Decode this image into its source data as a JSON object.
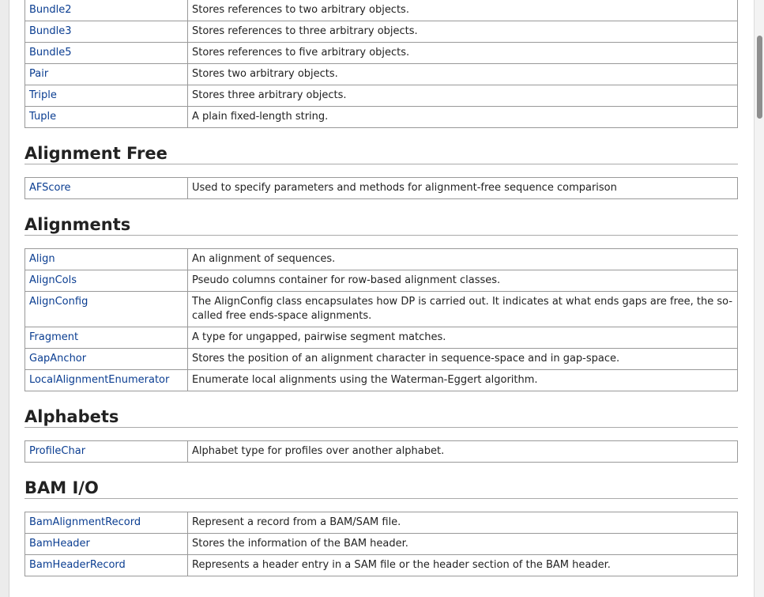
{
  "sections": [
    {
      "heading": "",
      "rows": [
        {
          "name": "Bundle2",
          "desc": "Stores references to two arbitrary objects."
        },
        {
          "name": "Bundle3",
          "desc": "Stores references to three arbitrary objects."
        },
        {
          "name": "Bundle5",
          "desc": "Stores references to five arbitrary objects."
        },
        {
          "name": "Pair",
          "desc": "Stores two arbitrary objects."
        },
        {
          "name": "Triple",
          "desc": "Stores three arbitrary objects."
        },
        {
          "name": "Tuple",
          "desc": "A plain fixed-length string."
        }
      ]
    },
    {
      "heading": "Alignment Free",
      "rows": [
        {
          "name": "AFScore",
          "desc": "Used to specify parameters and methods for alignment-free sequence comparison"
        }
      ]
    },
    {
      "heading": "Alignments",
      "rows": [
        {
          "name": "Align",
          "desc": "An alignment of sequences."
        },
        {
          "name": "AlignCols",
          "desc": "Pseudo columns container for row-based alignment classes."
        },
        {
          "name": "AlignConfig",
          "desc": "The AlignConfig class encapsulates how DP is carried out. It indicates at what ends gaps are free, the so-called free ends-space alignments."
        },
        {
          "name": "Fragment",
          "desc": "A type for ungapped, pairwise segment matches."
        },
        {
          "name": "GapAnchor",
          "desc": "Stores the position of an alignment character in sequence-space and in gap-space."
        },
        {
          "name": "LocalAlignmentEnumerator",
          "desc": "Enumerate local alignments using the Waterman-Eggert algorithm."
        }
      ]
    },
    {
      "heading": "Alphabets",
      "rows": [
        {
          "name": "ProfileChar",
          "desc": "Alphabet type for profiles over another alphabet."
        }
      ]
    },
    {
      "heading": "BAM I/O",
      "rows": [
        {
          "name": "BamAlignmentRecord",
          "desc": "Represent a record from a BAM/SAM file."
        },
        {
          "name": "BamHeader",
          "desc": "Stores the information of the BAM header."
        },
        {
          "name": "BamHeaderRecord",
          "desc": "Represents a header entry in a SAM file or the header section of the BAM header."
        }
      ]
    }
  ]
}
